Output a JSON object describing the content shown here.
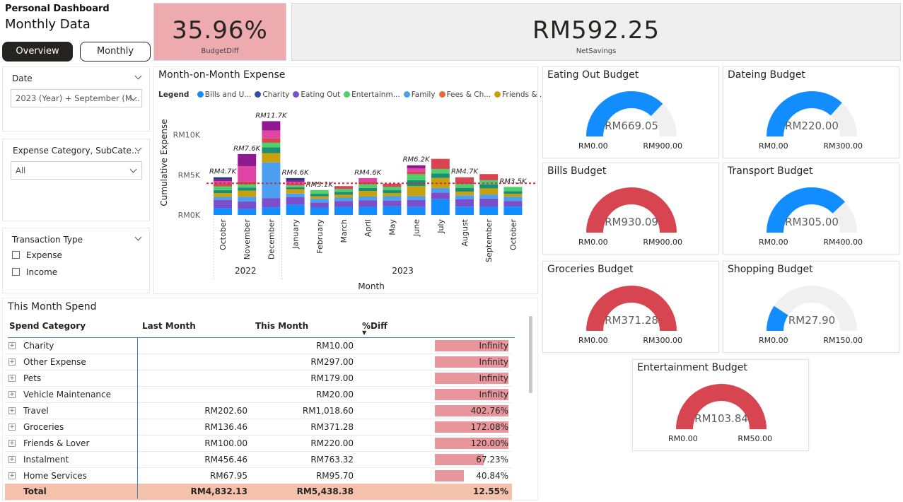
{
  "header": {
    "small_title": "Personal Dashboard",
    "big_title": "Monthly Data"
  },
  "nav": {
    "overview": "Overview",
    "monthly": "Monthly"
  },
  "kpis": {
    "budget_diff": {
      "value": "35.96%",
      "label": "BudgetDiff",
      "color": "#edabaf"
    },
    "net_savings": {
      "value": "RM592.25",
      "label": "NetSavings",
      "color": "#efefef"
    }
  },
  "slicers": {
    "date": {
      "title": "Date",
      "value": "2023 (Year) + September (M..."
    },
    "category": {
      "title": "Expense Category, SubCate...",
      "value": "All"
    },
    "transaction": {
      "title": "Transaction Type",
      "options": [
        "Expense",
        "Income"
      ]
    }
  },
  "chart_data": {
    "type": "bar",
    "title": "Month-on-Month Expense",
    "xlabel": "Month",
    "ylabel": "Cumulative Expense",
    "ylim": [
      0,
      12000
    ],
    "y_ticks": [
      "RM0K",
      "RM5K",
      "RM10K"
    ],
    "legend_title": "Legend",
    "legend": [
      {
        "name": "Bills and U...",
        "color": "#118dff"
      },
      {
        "name": "Charity",
        "color": "#3150a8"
      },
      {
        "name": "Eating Out",
        "color": "#7a4fc9"
      },
      {
        "name": "Entertainm...",
        "color": "#4ed06b"
      },
      {
        "name": "Family",
        "color": "#4a9ff0"
      },
      {
        "name": "Fees & Ch...",
        "color": "#e66c37"
      },
      {
        "name": "Friends & ...",
        "color": "#c7a10f"
      }
    ],
    "year_groups": [
      {
        "year": "2022",
        "count": 3
      },
      {
        "year": "2023",
        "count": 10
      }
    ],
    "categories": [
      "October",
      "November",
      "December",
      "January",
      "February",
      "March",
      "April",
      "May",
      "June",
      "July",
      "August",
      "September",
      "October"
    ],
    "values": [
      4700,
      7600,
      11700,
      4600,
      3100,
      3600,
      4600,
      3900,
      6200,
      7000,
      4700,
      5100,
      3500
    ],
    "data_labels": [
      "RM4.7K",
      "RM7.6K",
      "RM11.7K",
      "RM4.6K",
      "RM3.1K",
      "",
      "RM4.6K",
      "",
      "RM6.2K",
      "",
      "RM4.7K",
      "",
      "RM3.5K"
    ],
    "average_line": 3950,
    "segment_colors": [
      "#118dff",
      "#7a4fc9",
      "#4a9ff0",
      "#c7a10f",
      "#1a8f74",
      "#4ed06b",
      "#d64550",
      "#e044a7",
      "#8f1a8f",
      "#1a3d7c",
      "#e66c37",
      "#1f7a7a"
    ],
    "stack_shares": [
      [
        0.18,
        0.22,
        0.08,
        0.1,
        0.08,
        0.1,
        0.08,
        0.06,
        0.05,
        0.05
      ],
      [
        0.1,
        0.12,
        0.08,
        0.1,
        0.05,
        0.05,
        0.05,
        0.25,
        0.2
      ],
      [
        0.08,
        0.1,
        0.38,
        0.1,
        0.06,
        0.05,
        0.05,
        0.08,
        0.1
      ],
      [
        0.28,
        0.2,
        0.1,
        0.12,
        0.05,
        0.05,
        0.05,
        0.05,
        0.05,
        0.05
      ],
      [
        0.3,
        0.2,
        0.15,
        0.1,
        0.1,
        0.15
      ],
      [
        0.28,
        0.2,
        0.12,
        0.1,
        0.1,
        0.1,
        0.1
      ],
      [
        0.22,
        0.18,
        0.1,
        0.15,
        0.08,
        0.1,
        0.07,
        0.1
      ],
      [
        0.28,
        0.18,
        0.14,
        0.1,
        0.1,
        0.1,
        0.1
      ],
      [
        0.16,
        0.14,
        0.08,
        0.2,
        0.12,
        0.12,
        0.06,
        0.06,
        0.06
      ],
      [
        0.28,
        0.12,
        0.08,
        0.18,
        0.08,
        0.08,
        0.18
      ],
      [
        0.22,
        0.2,
        0.1,
        0.1,
        0.1,
        0.1,
        0.18
      ],
      [
        0.2,
        0.2,
        0.1,
        0.15,
        0.1,
        0.1,
        0.15
      ],
      [
        0.3,
        0.2,
        0.15,
        0.1,
        0.1,
        0.15
      ]
    ]
  },
  "gauges": [
    {
      "title": "Eating Out Budget",
      "value": "RM669.05",
      "min": "RM0.00",
      "max": "RM900.00",
      "fraction": 0.743,
      "color": "#118dff"
    },
    {
      "title": "Dateing Budget",
      "value": "RM220.00",
      "min": "RM0.00",
      "max": "RM300.00",
      "fraction": 0.733,
      "color": "#118dff"
    },
    {
      "title": "Bills Budget",
      "value": "RM930.09",
      "min": "RM0.00",
      "max": "RM900.00",
      "fraction": 1.0,
      "color": "#d64550"
    },
    {
      "title": "Transport Budget",
      "value": "RM305.00",
      "min": "RM0.00",
      "max": "RM400.00",
      "fraction": 0.7625,
      "color": "#118dff"
    },
    {
      "title": "Groceries Budget",
      "value": "RM371.28",
      "min": "RM0.00",
      "max": "RM300.00",
      "fraction": 1.0,
      "color": "#d64550"
    },
    {
      "title": "Shopping Budget",
      "value": "RM27.90",
      "min": "RM0.00",
      "max": "RM150.00",
      "fraction": 0.186,
      "color": "#118dff"
    },
    {
      "title": "Entertainment Budget",
      "value": "RM103.84",
      "min": "RM0.00",
      "max": "RM50.00",
      "fraction": 1.0,
      "color": "#d64550"
    }
  ],
  "gauge_track_color": "#f0f0f0",
  "table": {
    "title": "This Month Spend",
    "headers": {
      "category": "Spend Category",
      "last": "Last Month",
      "this": "This Month",
      "diff": "%Diff"
    },
    "rows": [
      {
        "category": "Charity",
        "last": "",
        "this": "RM10.00",
        "diff": "Infinity",
        "fill": 1.0
      },
      {
        "category": "Other Expense",
        "last": "",
        "this": "RM297.00",
        "diff": "Infinity",
        "fill": 1.0
      },
      {
        "category": "Pets",
        "last": "",
        "this": "RM179.00",
        "diff": "Infinity",
        "fill": 1.0
      },
      {
        "category": "Vehicle Maintenance",
        "last": "",
        "this": "RM20.00",
        "diff": "Infinity",
        "fill": 1.0
      },
      {
        "category": "Travel",
        "last": "RM202.60",
        "this": "RM1,018.60",
        "diff": "402.76%",
        "fill": 1.0
      },
      {
        "category": "Groceries",
        "last": "RM136.46",
        "this": "RM371.28",
        "diff": "172.08%",
        "fill": 1.0
      },
      {
        "category": "Friends & Lover",
        "last": "RM100.00",
        "this": "RM220.00",
        "diff": "120.00%",
        "fill": 1.0
      },
      {
        "category": "Instalment",
        "last": "RM456.46",
        "this": "RM763.32",
        "diff": "67.23%",
        "fill": 0.66
      },
      {
        "category": "Home Services",
        "last": "RM67.95",
        "this": "RM95.70",
        "diff": "40.84%",
        "fill": 0.39
      }
    ],
    "total": {
      "category": "Total",
      "last": "RM4,832.13",
      "this": "RM5,438.38",
      "diff": "12.55%"
    }
  }
}
